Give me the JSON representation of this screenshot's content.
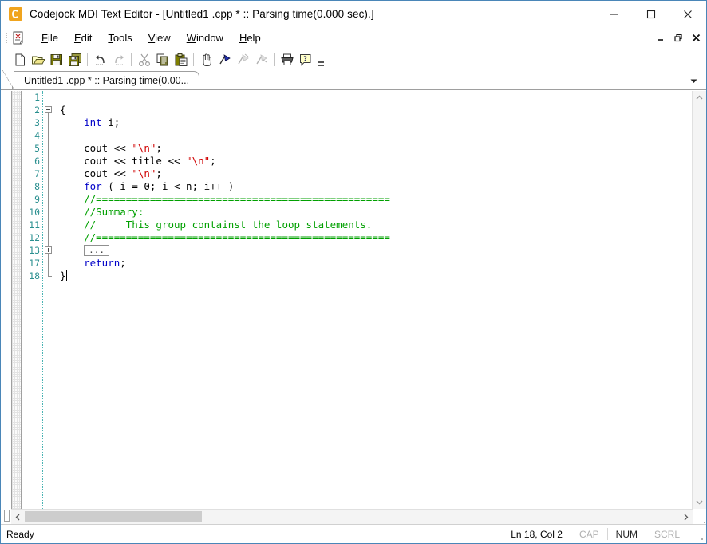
{
  "window": {
    "title": "Codejock MDI Text Editor - [Untitled1 .cpp * ::  Parsing time(0.000 sec).]",
    "logo_icon": "codejock-logo-icon",
    "controls": [
      {
        "name": "minimize-button",
        "icon": "minimize-icon"
      },
      {
        "name": "maximize-button",
        "icon": "maximize-icon"
      },
      {
        "name": "close-button",
        "icon": "close-icon"
      }
    ],
    "accent_border": "#4a86b8"
  },
  "menubar": {
    "doc_icon": "script-document-icon",
    "items": [
      {
        "label": "File",
        "mnemonic": "F"
      },
      {
        "label": "Edit",
        "mnemonic": "E"
      },
      {
        "label": "Tools",
        "mnemonic": "T"
      },
      {
        "label": "View",
        "mnemonic": "V"
      },
      {
        "label": "Window",
        "mnemonic": "W"
      },
      {
        "label": "Help",
        "mnemonic": "H"
      }
    ],
    "mdi_controls": [
      {
        "name": "mdi-minimize-button",
        "icon": "minimize-icon"
      },
      {
        "name": "mdi-restore-button",
        "icon": "restore-icon"
      },
      {
        "name": "mdi-close-button",
        "icon": "close-icon"
      }
    ]
  },
  "toolbar": {
    "buttons": [
      {
        "name": "new-button",
        "icon": "new-file-icon",
        "label": "New",
        "enabled": true
      },
      {
        "name": "open-button",
        "icon": "open-folder-icon",
        "label": "Open",
        "enabled": true
      },
      {
        "name": "save-button",
        "icon": "save-floppy-icon",
        "label": "Save",
        "enabled": true
      },
      {
        "name": "save-all-button",
        "icon": "save-all-icon",
        "label": "Save All",
        "enabled": true
      },
      {
        "name": "undo-button",
        "icon": "undo-arrow-icon",
        "label": "Undo",
        "enabled": true
      },
      {
        "name": "redo-button",
        "icon": "redo-arrow-icon",
        "label": "Redo",
        "enabled": false
      },
      {
        "name": "cut-button",
        "icon": "scissors-icon",
        "label": "Cut",
        "enabled": false
      },
      {
        "name": "copy-button",
        "icon": "copy-icon",
        "label": "Copy",
        "enabled": true
      },
      {
        "name": "paste-button",
        "icon": "clipboard-paste-icon",
        "label": "Paste",
        "enabled": true
      },
      {
        "name": "drag-button",
        "icon": "hand-icon",
        "label": "Drag",
        "enabled": true
      },
      {
        "name": "toggle-bookmark-button",
        "icon": "bookmark-flag-icon",
        "label": "Toggle Bookmark",
        "enabled": true
      },
      {
        "name": "prev-bookmark-button",
        "icon": "bookmark-prev-icon",
        "label": "Previous Bookmark",
        "enabled": false
      },
      {
        "name": "next-bookmark-button",
        "icon": "bookmark-next-icon",
        "label": "Next Bookmark",
        "enabled": false
      },
      {
        "name": "print-button",
        "icon": "printer-icon",
        "label": "Print",
        "enabled": true
      },
      {
        "name": "help-button",
        "icon": "help-question-icon",
        "label": "Help",
        "enabled": true
      }
    ],
    "overflow_label": "Toolbar Options"
  },
  "tabs": {
    "items": [
      {
        "label": "Untitled1 .cpp * ::  Parsing time(0.00...",
        "active": true
      }
    ],
    "list_button_icon": "chevron-down-icon"
  },
  "editor": {
    "lines": [
      {
        "num": "1",
        "fold": "",
        "tokens": []
      },
      {
        "num": "2",
        "fold": "minus",
        "tokens": [
          {
            "t": "{",
            "c": "pl"
          }
        ]
      },
      {
        "num": "3",
        "fold": "",
        "tokens": [
          {
            "t": "    ",
            "c": "pl"
          },
          {
            "t": "int",
            "c": "kw"
          },
          {
            "t": " i;",
            "c": "pl"
          }
        ]
      },
      {
        "num": "4",
        "fold": "",
        "tokens": []
      },
      {
        "num": "5",
        "fold": "",
        "tokens": [
          {
            "t": "    cout << ",
            "c": "pl"
          },
          {
            "t": "\"\\n\"",
            "c": "str"
          },
          {
            "t": ";",
            "c": "pl"
          }
        ]
      },
      {
        "num": "6",
        "fold": "",
        "tokens": [
          {
            "t": "    cout << title << ",
            "c": "pl"
          },
          {
            "t": "\"\\n\"",
            "c": "str"
          },
          {
            "t": ";",
            "c": "pl"
          }
        ]
      },
      {
        "num": "7",
        "fold": "",
        "tokens": [
          {
            "t": "    cout << ",
            "c": "pl"
          },
          {
            "t": "\"\\n\"",
            "c": "str"
          },
          {
            "t": ";",
            "c": "pl"
          }
        ]
      },
      {
        "num": "8",
        "fold": "",
        "tokens": [
          {
            "t": "    ",
            "c": "pl"
          },
          {
            "t": "for",
            "c": "kw"
          },
          {
            "t": " ( i = 0; i < n; i++ )",
            "c": "pl"
          }
        ]
      },
      {
        "num": "9",
        "fold": "",
        "tokens": [
          {
            "t": "    //=================================================",
            "c": "cmt"
          }
        ]
      },
      {
        "num": "10",
        "fold": "",
        "tokens": [
          {
            "t": "    //Summary:",
            "c": "cmt"
          }
        ]
      },
      {
        "num": "11",
        "fold": "",
        "tokens": [
          {
            "t": "    //     This group containst the loop statements.",
            "c": "cmt"
          }
        ]
      },
      {
        "num": "12",
        "fold": "",
        "tokens": [
          {
            "t": "    //=================================================",
            "c": "cmt"
          }
        ]
      },
      {
        "num": "13",
        "fold": "plus",
        "collapsed": "...",
        "tokens": []
      },
      {
        "num": "17",
        "fold": "",
        "tokens": [
          {
            "t": "    ",
            "c": "pl"
          },
          {
            "t": "return",
            "c": "kw"
          },
          {
            "t": ";",
            "c": "pl"
          }
        ]
      },
      {
        "num": "18",
        "fold": "end",
        "tokens": [
          {
            "t": "}",
            "c": "pl"
          }
        ],
        "caret": true
      }
    ],
    "colors": {
      "keyword": "#0000c8",
      "string": "#d00000",
      "comment": "#00a000",
      "plain": "#000000",
      "linenumber": "#2a8f8f"
    }
  },
  "scrollbars": {
    "vertical": {
      "up_icon": "chevron-up-icon",
      "down_icon": "chevron-down-icon"
    },
    "horizontal": {
      "left_icon": "chevron-left-icon",
      "right_icon": "chevron-right-icon"
    }
  },
  "statusbar": {
    "message": "Ready",
    "position": "Ln 18, Col 2",
    "indicators": [
      {
        "label": "CAP",
        "active": false
      },
      {
        "label": "NUM",
        "active": true
      },
      {
        "label": "SCRL",
        "active": false
      }
    ],
    "resize_grip": "resize-grip-icon"
  }
}
